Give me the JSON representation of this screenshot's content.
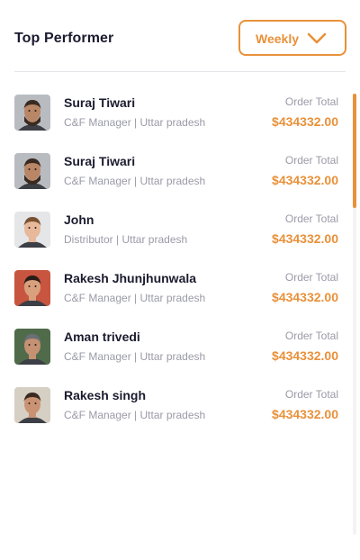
{
  "header": {
    "title": "Top Performer",
    "period_dropdown": {
      "selected": "Weekly",
      "icon": "chevron-down-icon"
    }
  },
  "performers": [
    {
      "name": "Suraj Tiwari",
      "role": "C&F Manager | Uttar pradesh",
      "order_label": "Order Total",
      "order_total": "$434332.00",
      "avatar": {
        "bg": "#b8bcc0",
        "skin": "#b98666",
        "hair": "#3a2b22",
        "beard": true
      }
    },
    {
      "name": "Suraj Tiwari",
      "role": "C&F Manager | Uttar pradesh",
      "order_label": "Order Total",
      "order_total": "$434332.00",
      "avatar": {
        "bg": "#b8bcc0",
        "skin": "#b98666",
        "hair": "#3a2b22",
        "beard": true
      }
    },
    {
      "name": "John",
      "role": "Distributor | Uttar pradesh",
      "order_label": "Order Total",
      "order_total": "$434332.00",
      "avatar": {
        "bg": "#e4e6e8",
        "skin": "#e8b89a",
        "hair": "#7a5232",
        "beard": false
      }
    },
    {
      "name": "Rakesh Jhunjhunwala",
      "role": "C&F Manager | Uttar pradesh",
      "order_label": "Order Total",
      "order_total": "$434332.00",
      "avatar": {
        "bg": "#c8553f",
        "skin": "#d9a07e",
        "hair": "#2a1d18",
        "beard": false
      }
    },
    {
      "name": "Aman trivedi",
      "role": "C&F Manager | Uttar pradesh",
      "order_label": "Order Total",
      "order_total": "$434332.00",
      "avatar": {
        "bg": "#4f6b4a",
        "skin": "#c49173",
        "hair": "#6b6f75",
        "beard": false
      }
    },
    {
      "name": "Rakesh singh",
      "role": "C&F Manager | Uttar pradesh",
      "order_label": "Order Total",
      "order_total": "$434332.00",
      "avatar": {
        "bg": "#d6cfc4",
        "skin": "#c99373",
        "hair": "#3b2a21",
        "beard": false
      }
    }
  ],
  "colors": {
    "accent": "#e8913a",
    "text_primary": "#1b1b2f",
    "text_secondary": "#9a9aa8",
    "divider": "#e6e6ea"
  }
}
